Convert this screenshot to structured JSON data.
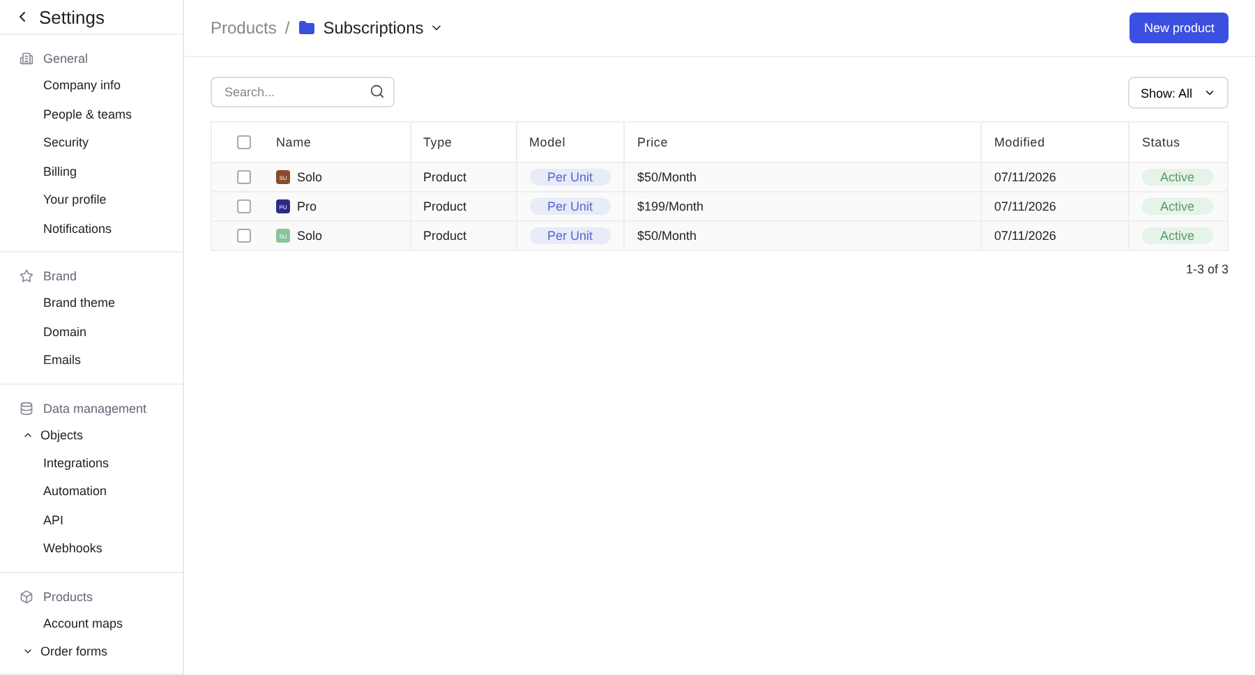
{
  "sidebar": {
    "title": "Settings",
    "sections": [
      {
        "label": "General",
        "items": [
          {
            "kind": "link",
            "label": "Company info"
          },
          {
            "kind": "link",
            "label": "People & teams"
          },
          {
            "kind": "link",
            "label": "Security"
          },
          {
            "kind": "link",
            "label": "Billing"
          },
          {
            "kind": "link",
            "label": "Your profile"
          },
          {
            "kind": "link",
            "label": "Notifications"
          }
        ]
      },
      {
        "label": "Brand",
        "items": [
          {
            "kind": "link",
            "label": "Brand theme"
          },
          {
            "kind": "link",
            "label": "Domain"
          },
          {
            "kind": "link",
            "label": "Emails"
          }
        ]
      },
      {
        "label": "Data management",
        "items": [
          {
            "kind": "group",
            "label": "Objects",
            "expanded": true
          },
          {
            "kind": "link",
            "label": "Integrations"
          },
          {
            "kind": "link",
            "label": "Automation"
          },
          {
            "kind": "link",
            "label": "API"
          },
          {
            "kind": "link",
            "label": "Webhooks"
          }
        ]
      },
      {
        "label": "Products",
        "items": [
          {
            "kind": "link",
            "label": "Account maps"
          },
          {
            "kind": "group",
            "label": "Order forms",
            "expanded": false
          }
        ]
      }
    ]
  },
  "breadcrumb": {
    "parent": "Products",
    "separator": "/",
    "current": "Subscriptions"
  },
  "new_button": "New product",
  "search": {
    "placeholder": "Search..."
  },
  "filter": "Show: All",
  "table": {
    "columns": [
      "Name",
      "Type",
      "Model",
      "Price",
      "Modified",
      "Status"
    ],
    "header_checked": false,
    "rows": [
      {
        "checked": false,
        "badge": "SU",
        "color": "#8a4b2a",
        "name": "Solo",
        "type": "Product",
        "model": "Per Unit",
        "price": "$50/Month",
        "modified": "07/11/2026",
        "status": "Active"
      },
      {
        "checked": false,
        "badge": "PU",
        "color": "#2e2a8c",
        "name": "Pro",
        "type": "Product",
        "model": "Per Unit",
        "price": "$199/Month",
        "modified": "07/11/2026",
        "status": "Active"
      },
      {
        "checked": false,
        "badge": "SU",
        "color": "#8cc49a",
        "name": "Solo",
        "type": "Product",
        "model": "Per Unit",
        "price": "$50/Month",
        "modified": "07/11/2026",
        "status": "Active"
      }
    ]
  },
  "pagination": "1-3 of 3"
}
